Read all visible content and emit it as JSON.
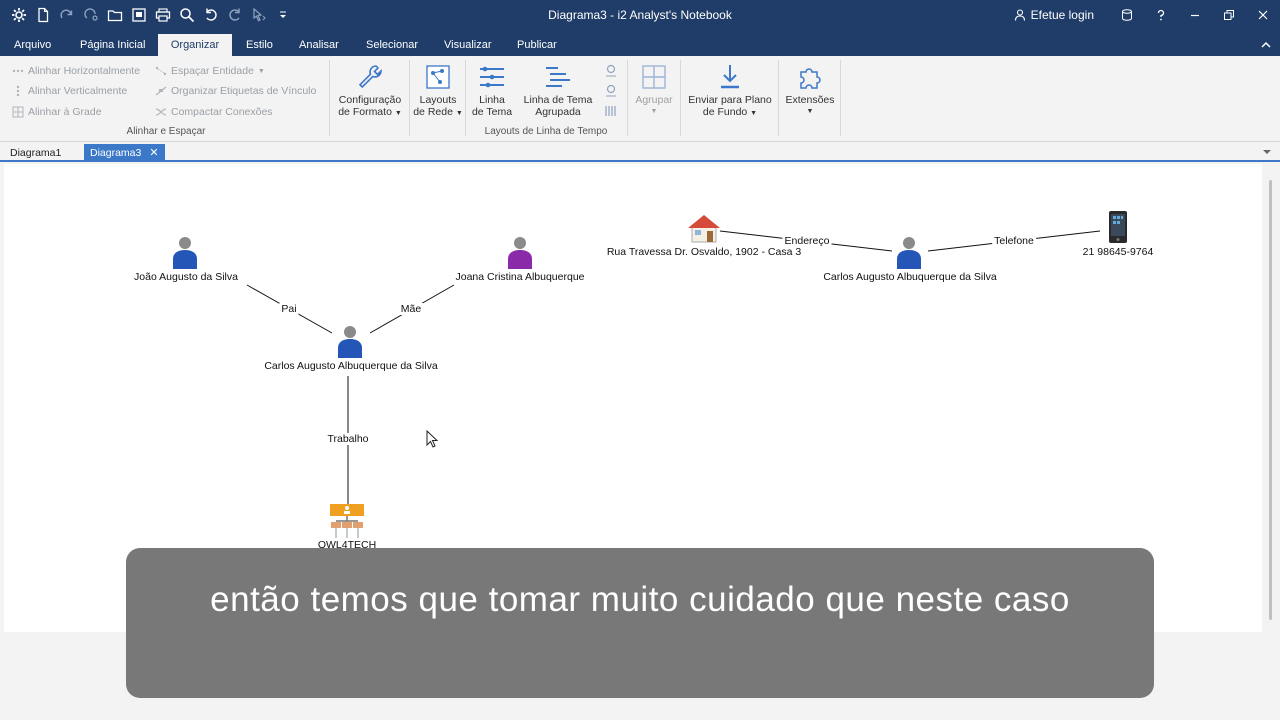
{
  "window": {
    "title": "Diagrama3 - i2 Analyst's Notebook",
    "login_label": "Efetue login"
  },
  "ribbon_tabs": [
    {
      "label": "Arquivo"
    },
    {
      "label": "Página Inicial"
    },
    {
      "label": "Organizar",
      "active": true
    },
    {
      "label": "Estilo"
    },
    {
      "label": "Analisar"
    },
    {
      "label": "Selecionar"
    },
    {
      "label": "Visualizar"
    },
    {
      "label": "Publicar"
    }
  ],
  "ribbon": {
    "align_group": {
      "label": "Alinhar e Espaçar",
      "align_horizontal": "Alinhar Horizontalmente",
      "align_vertical": "Alinhar Verticalmente",
      "align_grid": "Alinhar à Grade",
      "space_entity": "Espaçar Entidade",
      "arrange_link_labels": "Organizar Etiquetas de Vínculo",
      "compact_connections": "Compactar Conexões"
    },
    "format_config": {
      "line1": "Configuração",
      "line2": "de Formato"
    },
    "network_layouts": {
      "line1": "Layouts",
      "line2": "de Rede"
    },
    "timeline_group": {
      "label": "Layouts de Linha de Tempo",
      "theme_line": {
        "line1": "Linha",
        "line2": "de Tema"
      },
      "grouped_theme_line": {
        "line1": "Linha de Tema",
        "line2": "Agrupada"
      }
    },
    "group_button": "Agrupar",
    "send_to_background": {
      "line1": "Enviar para Plano",
      "line2": "de Fundo"
    },
    "extensions": "Extensões"
  },
  "doc_tabs": [
    {
      "label": "Diagrama1"
    },
    {
      "label": "Diagrama3",
      "active": true
    }
  ],
  "chart": {
    "entities": {
      "joao": "João Augusto da Silva",
      "joana": "Joana Cristina Albuquerque",
      "carlos_main": "Carlos Augusto Albuquerque da Silva",
      "owl": "OWL4TECH",
      "address": "Rua Travessa Dr. Osvaldo, 1902 - Casa 3",
      "carlos_right": "Carlos Augusto Albuquerque da Silva",
      "phone": "21 98645-9764"
    },
    "links": {
      "father": "Pai",
      "mother": "Mãe",
      "work": "Trabalho",
      "address": "Endereço",
      "phone": "Telefone"
    }
  },
  "subtitle": {
    "text": "então temos que tomar muito cuidado que neste caso"
  },
  "colors": {
    "title_bar": "#1f3d68",
    "accent": "#3c78c8",
    "person_male": "#2456b8",
    "person_female": "#8a2aa8",
    "organization": "#f0a020"
  }
}
